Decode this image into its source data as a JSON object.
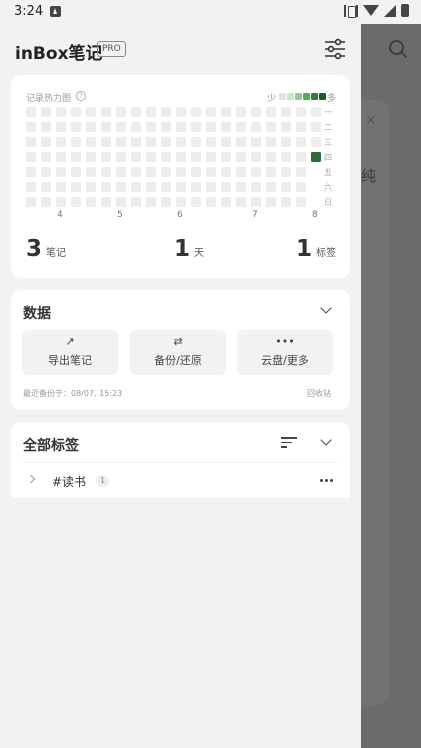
{
  "status_bar": {
    "time": "3:24"
  },
  "header": {
    "app_title": "inBox笔记",
    "pro_badge": "PRO"
  },
  "heatmap": {
    "label": "记录热力图",
    "legend_less": "少",
    "legend_more": "多",
    "legend_colors": [
      "#e3e3e6",
      "#c7e3c7",
      "#8fcc8f",
      "#4caf50",
      "#2e7d32",
      "#1b5e20"
    ],
    "empty_color": "#ececef",
    "active_color": "#2e6b35",
    "columns": 20,
    "rows": 7,
    "weekdays": [
      "一",
      "二",
      "三",
      "四",
      "五",
      "六",
      "日"
    ],
    "months": [
      {
        "label": "4",
        "column": 2
      },
      {
        "label": "5",
        "column": 6
      },
      {
        "label": "6",
        "column": 10
      },
      {
        "label": "7",
        "column": 15
      },
      {
        "label": "8",
        "column": 19
      }
    ],
    "active_cells": [
      {
        "column": 19,
        "row": 3,
        "level": 5
      }
    ],
    "hidden_after": {
      "column": 19,
      "row": 4
    }
  },
  "stats": [
    {
      "value": "3",
      "unit": "笔记"
    },
    {
      "value": "1",
      "unit": "天"
    },
    {
      "value": "1",
      "unit": "标签"
    }
  ],
  "data_section": {
    "title": "数据",
    "buttons": [
      {
        "icon": "↗",
        "label": "导出笔记"
      },
      {
        "icon": "⇄",
        "label": "备份/还原"
      },
      {
        "icon": "•••",
        "label": "云盘/更多"
      }
    ],
    "last_backup": "最近备份于：08/07, 15:23",
    "trash": "回收站"
  },
  "tags_section": {
    "title": "全部标签",
    "tags": [
      {
        "name": "#读书",
        "count": "1"
      }
    ]
  },
  "background": {
    "glyph": "纯"
  }
}
